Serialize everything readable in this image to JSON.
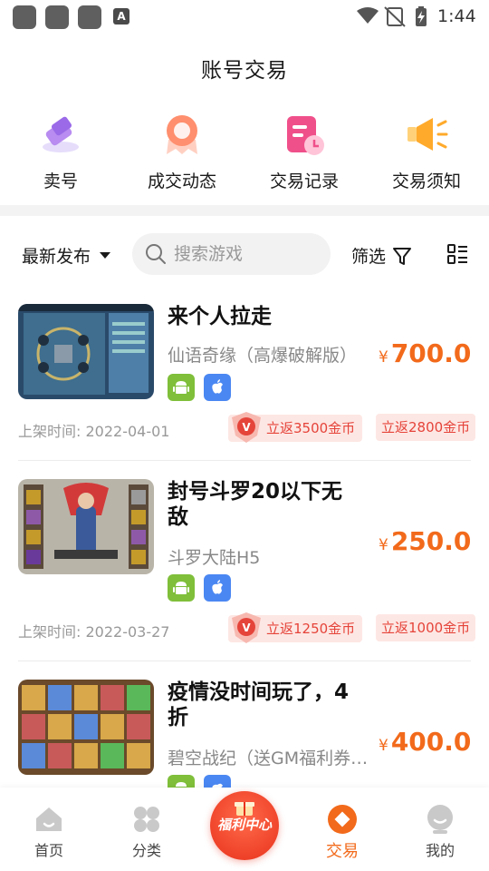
{
  "status_bar": {
    "time": "1:44",
    "a_label": "A"
  },
  "header": {
    "title": "账号交易"
  },
  "quick_menu": [
    {
      "label": "卖号",
      "icon": "sell-tag-icon"
    },
    {
      "label": "成交动态",
      "icon": "deal-activity-icon"
    },
    {
      "label": "交易记录",
      "icon": "trade-record-icon"
    },
    {
      "label": "交易须知",
      "icon": "trade-notice-icon"
    }
  ],
  "filters": {
    "sort_label": "最新发布",
    "search_placeholder": "搜索游戏",
    "filter_label": "筛选"
  },
  "listings": [
    {
      "title": "来个人拉走",
      "game": "仙语奇缘（高爆破解版）",
      "price": "700.0",
      "currency": "¥",
      "platforms": [
        "android",
        "ios"
      ],
      "date": "上架时间: 2022-04-01",
      "vip_rebate": "立返3500金币",
      "rebate": "立返2800金币"
    },
    {
      "title": "封号斗罗20以下无敌",
      "game": "斗罗大陆H5",
      "price": "250.0",
      "currency": "¥",
      "platforms": [
        "android",
        "ios"
      ],
      "date": "上架时间: 2022-03-27",
      "vip_rebate": "立返1250金币",
      "rebate": "立返1000金币"
    },
    {
      "title": "疫情没时间玩了，4折",
      "game": "碧空战纪（送GM福利券…",
      "price": "400.0",
      "currency": "¥",
      "platforms": [
        "android",
        "ios"
      ]
    }
  ],
  "bottom_nav": {
    "home": "首页",
    "category": "分类",
    "center": "福利中心",
    "trade": "交易",
    "mine": "我的"
  },
  "colors": {
    "accent": "#f26a1b",
    "rebate_text": "#e5443a",
    "rebate_bg": "#fde7e4",
    "android": "#7fbf3a",
    "ios": "#4a87f2"
  }
}
